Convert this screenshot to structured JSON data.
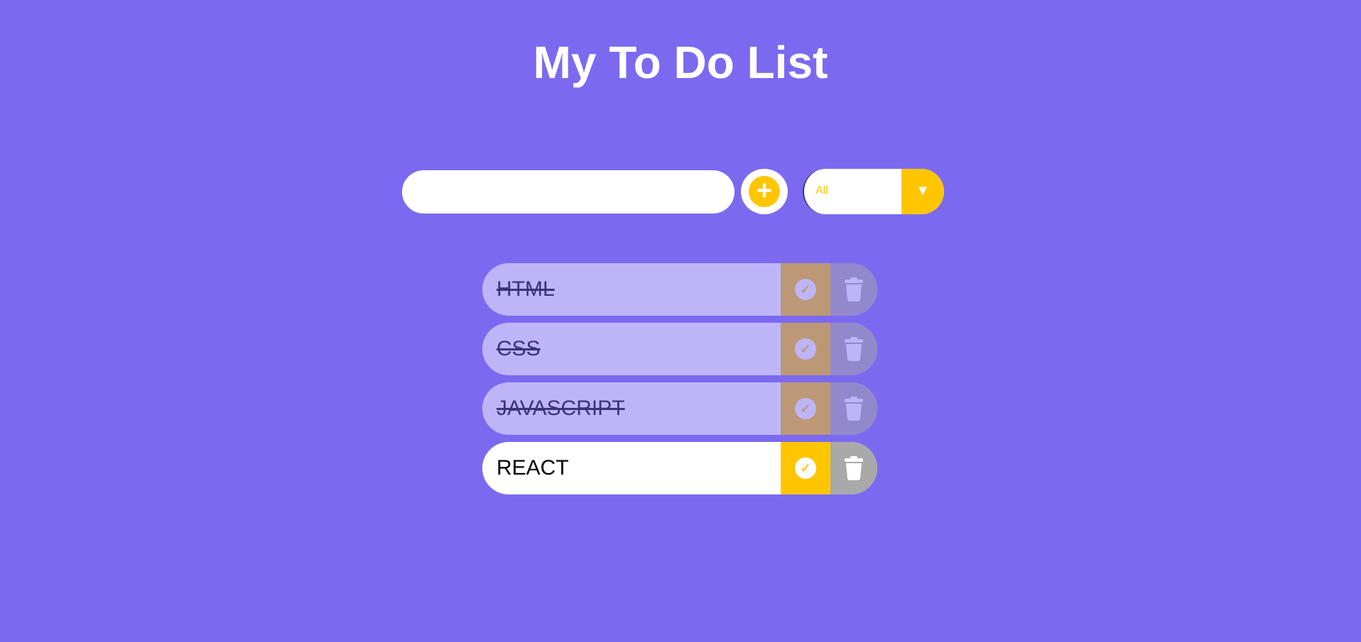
{
  "header": {
    "title": "My To Do List"
  },
  "form": {
    "input_value": "",
    "add_icon": "plus-icon",
    "filter": {
      "selected": "All",
      "arrow_icon": "chevron-down-icon"
    }
  },
  "todos": [
    {
      "text": "HTML",
      "completed": true
    },
    {
      "text": "CSS",
      "completed": true
    },
    {
      "text": "JAVASCRIPT",
      "completed": true
    },
    {
      "text": "REACT",
      "completed": false
    }
  ],
  "icons": {
    "complete": "check-icon",
    "delete": "trash-icon"
  },
  "colors": {
    "background": "#7b6af0",
    "accent": "#ffc600",
    "delete": "#a9a9a9",
    "item_background": "#ffffff",
    "filter_border": "#3b2e86"
  }
}
